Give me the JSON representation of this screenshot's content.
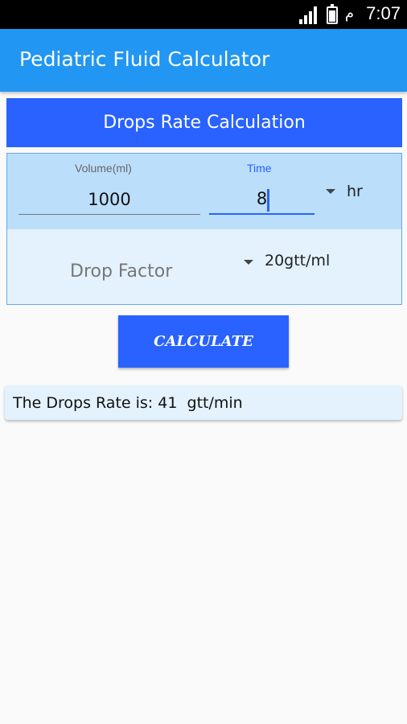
{
  "status_bar": {
    "time": "7:07",
    "carrier": "م"
  },
  "app_bar": {
    "title": "Pediatric Fluid Calculator"
  },
  "section": {
    "header": "Drops Rate Calculation"
  },
  "volume": {
    "label": "Volume(ml)",
    "value": "1000"
  },
  "time": {
    "label": "Time",
    "value": "8",
    "unit": "hr"
  },
  "drop_factor": {
    "label": "Drop Factor",
    "value": "20gtt/ml"
  },
  "calculate": {
    "label": "CALCULATE"
  },
  "result": {
    "text": "The Drops Rate is: 41  gtt/min"
  },
  "colors": {
    "app_bar": "#2196f3",
    "accent": "#2962ff",
    "light_blue": "#bbdefb",
    "pale_blue": "#e3f2fd"
  }
}
